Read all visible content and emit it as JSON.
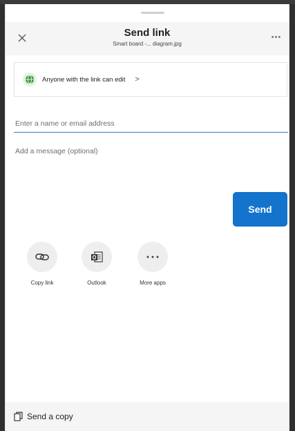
{
  "header": {
    "title": "Send link",
    "subtitle": "Smart board -... diagram.jpg"
  },
  "permission": {
    "label": "Anyone with the link can edit"
  },
  "email": {
    "placeholder": "Enter a name or email address",
    "value": ""
  },
  "message": {
    "placeholder": "Add a message (optional)",
    "value": ""
  },
  "send": {
    "label": "Send"
  },
  "apps": [
    {
      "label": "Copy link",
      "icon": "link-icon"
    },
    {
      "label": "Outlook",
      "icon": "outlook-icon"
    },
    {
      "label": "More apps",
      "icon": "more-horizontal-icon"
    }
  ],
  "footer": {
    "label": "Send a copy",
    "icon": "copy-document-icon"
  },
  "colors": {
    "accent": "#1473cc",
    "input_underline": "#2f7bd6",
    "globe_green": "#3a9a3a",
    "globe_bg": "#e4f2e4"
  }
}
